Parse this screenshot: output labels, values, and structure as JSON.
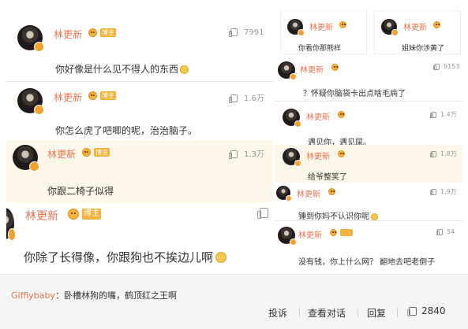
{
  "left_comments": [
    {
      "user": "林更新",
      "badge": "博主",
      "likes": "7991",
      "text": "你好像是什么见不得人的东西"
    },
    {
      "user": "林更新",
      "badge": "博主",
      "likes": "1.6万",
      "text": "你怎么虎了吧唧的呢，治治脑子。"
    },
    {
      "user": "林更新",
      "badge": "博主",
      "likes": "1.3万",
      "text": "你跟二椅子似得"
    },
    {
      "user": "林更新",
      "badge": "博主",
      "likes": "",
      "text": "你除了长得像，你跟狗也不挨边儿啊"
    }
  ],
  "right_top": [
    {
      "user": "林更新",
      "text": "你看你那熊样"
    },
    {
      "user": "林更新",
      "text": "姐妹你涉黄了"
    }
  ],
  "right_comments": [
    {
      "user": "林更新",
      "likes": "9153",
      "text": "？怀疑你脑袋卡出点啥毛病了"
    },
    {
      "user": "林更新",
      "likes": "1.4万",
      "text": "遇见你，遇见屎。"
    },
    {
      "user": "林更新",
      "likes": "1.8万",
      "text": "给爷整笑了"
    },
    {
      "user": "林更新",
      "likes": "1.9万",
      "text": "锤到你妈不认识你呢"
    },
    {
      "user": "林更新",
      "likes": "54",
      "text": "没有钱，你上什么网？ 翻地去吧老倒子"
    }
  ],
  "bottom": {
    "username": "Giffiybaby",
    "comment": "：卧槽林狗的嘴，鹤顶红之王啊",
    "action_report": "投诉",
    "action_view": "查看对话",
    "action_reply": "回复",
    "likes": "2840"
  },
  "colors": {
    "name": "#eb7350",
    "badge": "#f6b23c",
    "highlight": "#fdf7e9",
    "bottom_bg": "#f5f5f5"
  }
}
